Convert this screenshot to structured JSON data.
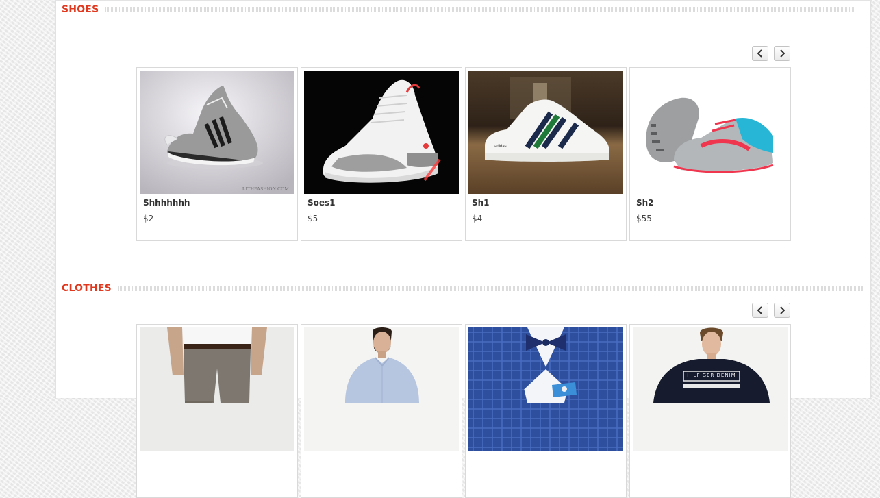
{
  "sections": {
    "shoes": {
      "title": "SHOES",
      "products": [
        {
          "name": "Shhhhhhh",
          "price": "$2",
          "watermark": "LITHFASHION.COM"
        },
        {
          "name": "Soes1",
          "price": "$5"
        },
        {
          "name": "Sh1",
          "price": "$4"
        },
        {
          "name": "Sh2",
          "price": "$55"
        }
      ]
    },
    "clothes": {
      "title": "CLOTHES",
      "products": [
        {
          "name": "",
          "price": ""
        },
        {
          "name": "",
          "price": ""
        },
        {
          "name": "",
          "price": ""
        },
        {
          "name": "",
          "price": "",
          "shirt_print": "HILFIGER DENIM"
        }
      ]
    }
  },
  "icons": {
    "prev": "chevron-left-icon",
    "next": "chevron-right-icon"
  },
  "colors": {
    "accent": "#e0391f",
    "page_bg": "#f1f1f1",
    "card_border": "#d9d9d9"
  }
}
